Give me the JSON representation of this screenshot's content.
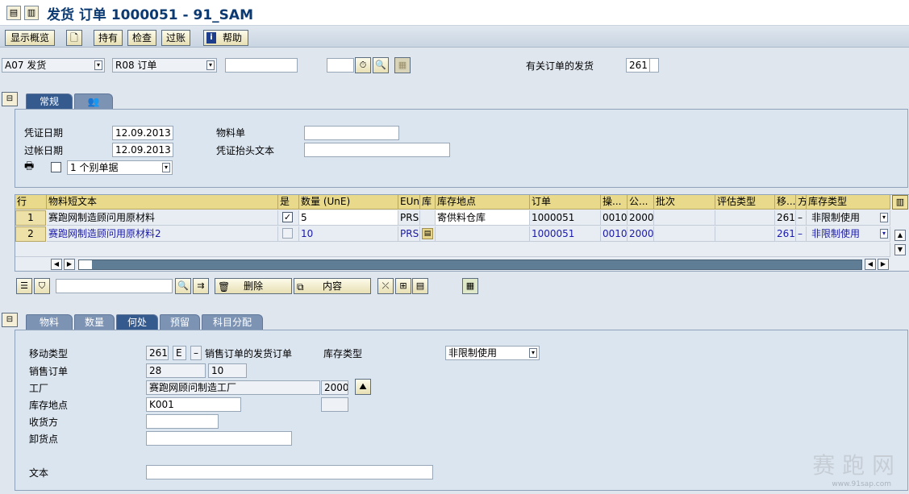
{
  "window": {
    "title": "发货 订单 1000051 - 91_SAM"
  },
  "toolbar": {
    "overview": "显示概览",
    "hold": "持有",
    "check": "检查",
    "post": "过账",
    "help": "帮助"
  },
  "header": {
    "action": "A07 发货",
    "reference": "R08 订单",
    "reference_value": "",
    "mvt_label": "有关订单的发货",
    "mvt_value": "261"
  },
  "tabs_top": {
    "general": "常规"
  },
  "general": {
    "doc_date_label": "凭证日期",
    "doc_date": "12.09.2013",
    "post_date_label": "过帐日期",
    "post_date": "12.09.2013",
    "material_slip_label": "物料单",
    "header_text_label": "凭证抬头文本",
    "print_option": "1 个别单据"
  },
  "grid": {
    "columns": [
      "行",
      "物料短文本",
      "是",
      "数量 (UnE)",
      "EUn",
      "库",
      "库存地点",
      "订单",
      "操...",
      "公...",
      "批次",
      "评估类型",
      "移...",
      "方",
      "库存类型"
    ],
    "rows": [
      {
        "line": "1",
        "text": "赛跑网制造顾问用原材料",
        "ok": true,
        "qty": "5",
        "unit": "PRS",
        "sloc": "寄供料仓库",
        "order": "1000051",
        "op": "0010",
        "plant": "2000",
        "mvt": "261",
        "sign": "–",
        "stock_type": "非限制使用"
      },
      {
        "line": "2",
        "text": "赛跑网制造顾问用原材料2",
        "ok": false,
        "qty": "10",
        "unit": "PRS",
        "sloc": "",
        "order": "1000051",
        "op": "0010",
        "plant": "2000",
        "mvt": "261",
        "sign": "–",
        "stock_type": "非限制使用"
      }
    ]
  },
  "grid_tools": {
    "delete": "删除",
    "contents": "内容"
  },
  "tabs_bottom": {
    "material": "物料",
    "quantity": "数量",
    "where": "何处",
    "reservation": "预留",
    "account": "科目分配"
  },
  "detail": {
    "mvt_type_label": "移动类型",
    "mvt_type": "261",
    "mvt_ind": "E",
    "mvt_sign": "–",
    "mvt_desc": "销售订单的发货订单",
    "stock_type_label": "库存类型",
    "stock_type": "非限制使用",
    "so_label": "销售订单",
    "so": "28",
    "so_item": "10",
    "plant_label": "工厂",
    "plant_name": "赛跑网顾问制造工厂",
    "plant": "2000",
    "sloc_label": "库存地点",
    "sloc": "K001",
    "recipient_label": "收货方",
    "unloading_label": "卸货点",
    "text_label": "文本"
  },
  "watermark": {
    "brand": "赛 跑 网",
    "url": "www.91sap.com"
  }
}
